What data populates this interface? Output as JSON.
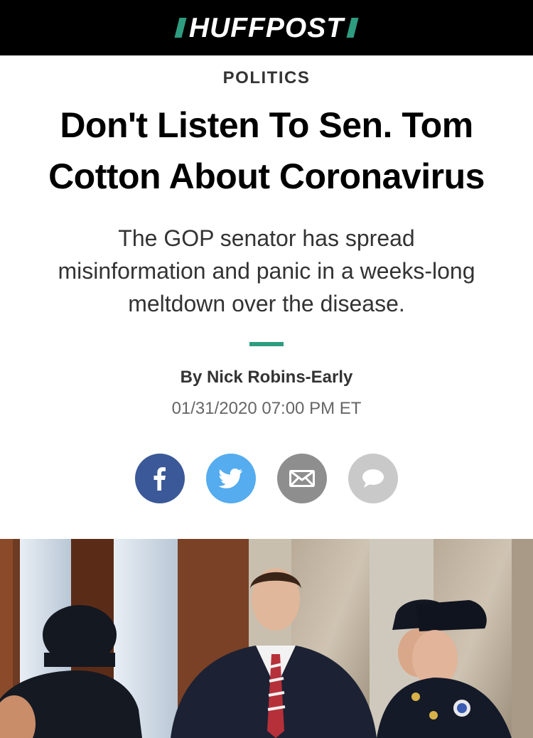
{
  "header": {
    "logo_text": "HUFFPOST",
    "background": "#000000",
    "accent": "#2e9c7e"
  },
  "article": {
    "section": "POLITICS",
    "headline_line1": "Don't Listen To Sen. Tom",
    "headline_line2": "Cotton About Coronavirus",
    "dek_line1": "The GOP senator has spread",
    "dek_line2": "misinformation and panic in a weeks-long",
    "dek_line3": "meltdown over the disease.",
    "byline": "By Nick Robins-Early",
    "timestamp": "01/31/2020 07:00 PM ET"
  },
  "share": {
    "buttons": [
      {
        "icon": "facebook-icon",
        "color": "#3b5998"
      },
      {
        "icon": "twitter-icon",
        "color": "#55acee"
      },
      {
        "icon": "email-icon",
        "color": "#8e8e8e"
      },
      {
        "icon": "comment-icon",
        "color": "#c9c9c9"
      }
    ]
  },
  "photo": {
    "icon": "lead-photo"
  }
}
